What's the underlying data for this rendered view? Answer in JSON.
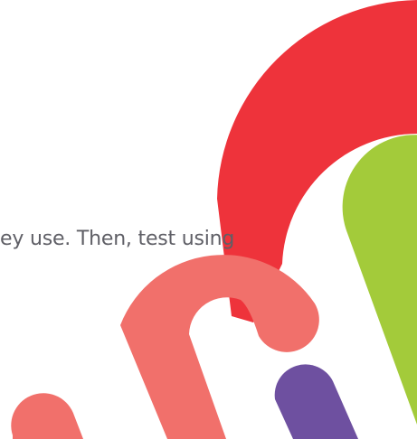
{
  "slide": {
    "body_text": "ey use. Then, test using"
  },
  "colors": {
    "background": "#ffffff",
    "text": "#5f5f66",
    "red": "#ee333b",
    "salmon": "#f1706b",
    "lime": "#a3cb3a",
    "purple": "#6e50a0"
  },
  "decorations": [
    {
      "name": "red-arc-shape",
      "color": "red"
    },
    {
      "name": "lime-stripe-shape",
      "color": "lime"
    },
    {
      "name": "salmon-hook-shape",
      "color": "salmon"
    },
    {
      "name": "salmon-stub-shape",
      "color": "salmon"
    },
    {
      "name": "purple-stub-shape",
      "color": "purple"
    }
  ]
}
